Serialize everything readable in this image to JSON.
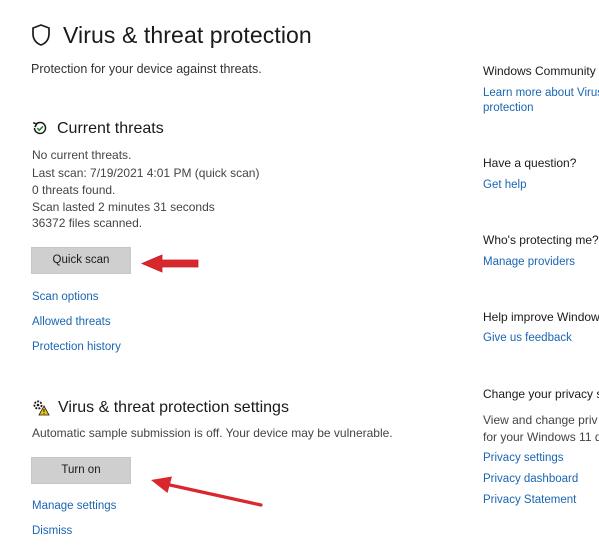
{
  "page": {
    "title": "Virus & threat protection",
    "subtitle": "Protection for your device against threats."
  },
  "current_threats": {
    "title": "Current threats",
    "lines": [
      "No current threats.",
      "Last scan: 7/19/2021 4:01 PM (quick scan)",
      "0 threats found.",
      "Scan lasted 2 minutes 31 seconds",
      "36372 files scanned."
    ],
    "quick_scan_label": "Quick scan",
    "links": [
      "Scan options",
      "Allowed threats",
      "Protection history"
    ]
  },
  "settings": {
    "title": "Virus & threat protection settings",
    "message": "Automatic sample submission is off. Your device may be vulnerable.",
    "turn_on_label": "Turn on",
    "links": [
      "Manage settings",
      "Dismiss"
    ]
  },
  "sidebar": {
    "community": {
      "heading": "Windows Community",
      "link_line1": "Learn more about Virus",
      "link_line2": "protection"
    },
    "question": {
      "heading": "Have a question?",
      "link": "Get help"
    },
    "protecting": {
      "heading": "Who's protecting me?",
      "link": "Manage providers"
    },
    "improve": {
      "heading": "Help improve Window",
      "link": "Give us feedback"
    },
    "privacy": {
      "heading": "Change your privacy s",
      "text_line1": "View and change priv",
      "text_line2": "for your Windows 11 d",
      "links": [
        "Privacy settings",
        "Privacy dashboard",
        "Privacy Statement"
      ]
    }
  },
  "annotations": {
    "arrow_color": "#d9272e"
  }
}
